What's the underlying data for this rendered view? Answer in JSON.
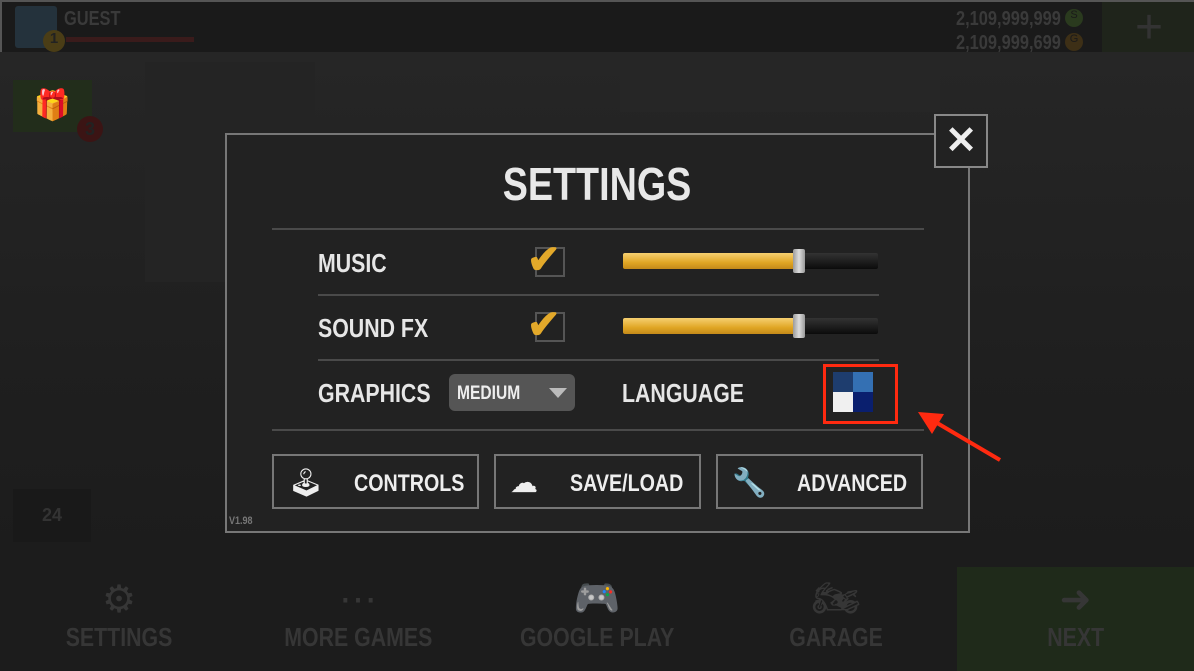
{
  "header": {
    "player_name": "GUEST",
    "level": "1",
    "silver_amount": "2,109,999,999",
    "gold_amount": "2,109,999,699",
    "silver_icon": "S",
    "gold_icon": "G",
    "add_icon": "+"
  },
  "side": {
    "gift_badge": "3",
    "timer_label": "24"
  },
  "settings": {
    "title": "SETTINGS",
    "music_label": "MUSIC",
    "music_enabled": true,
    "music_volume": 0.69,
    "soundfx_label": "SOUND FX",
    "soundfx_enabled": true,
    "soundfx_volume": 0.69,
    "graphics_label": "GRAPHICS",
    "graphics_value": "MEDIUM",
    "language_label": "LANGUAGE",
    "buttons": {
      "controls": "CONTROLS",
      "saveload": "SAVE/LOAD",
      "advanced": "ADVANCED"
    },
    "version": "V1.98",
    "close_icon": "✕"
  },
  "bottom_nav": [
    {
      "label": "SETTINGS",
      "icon": "⚙"
    },
    {
      "label": "MORE GAMES",
      "icon": "⋯"
    },
    {
      "label": "GOOGLE PLAY",
      "icon": "🎮"
    },
    {
      "label": "GARAGE",
      "icon": "🏍"
    },
    {
      "label": "NEXT",
      "icon": "➜"
    }
  ],
  "colors": {
    "accent": "#e3a92a",
    "highlight": "#ff2a10",
    "next_bg": "#1f2a1a"
  }
}
